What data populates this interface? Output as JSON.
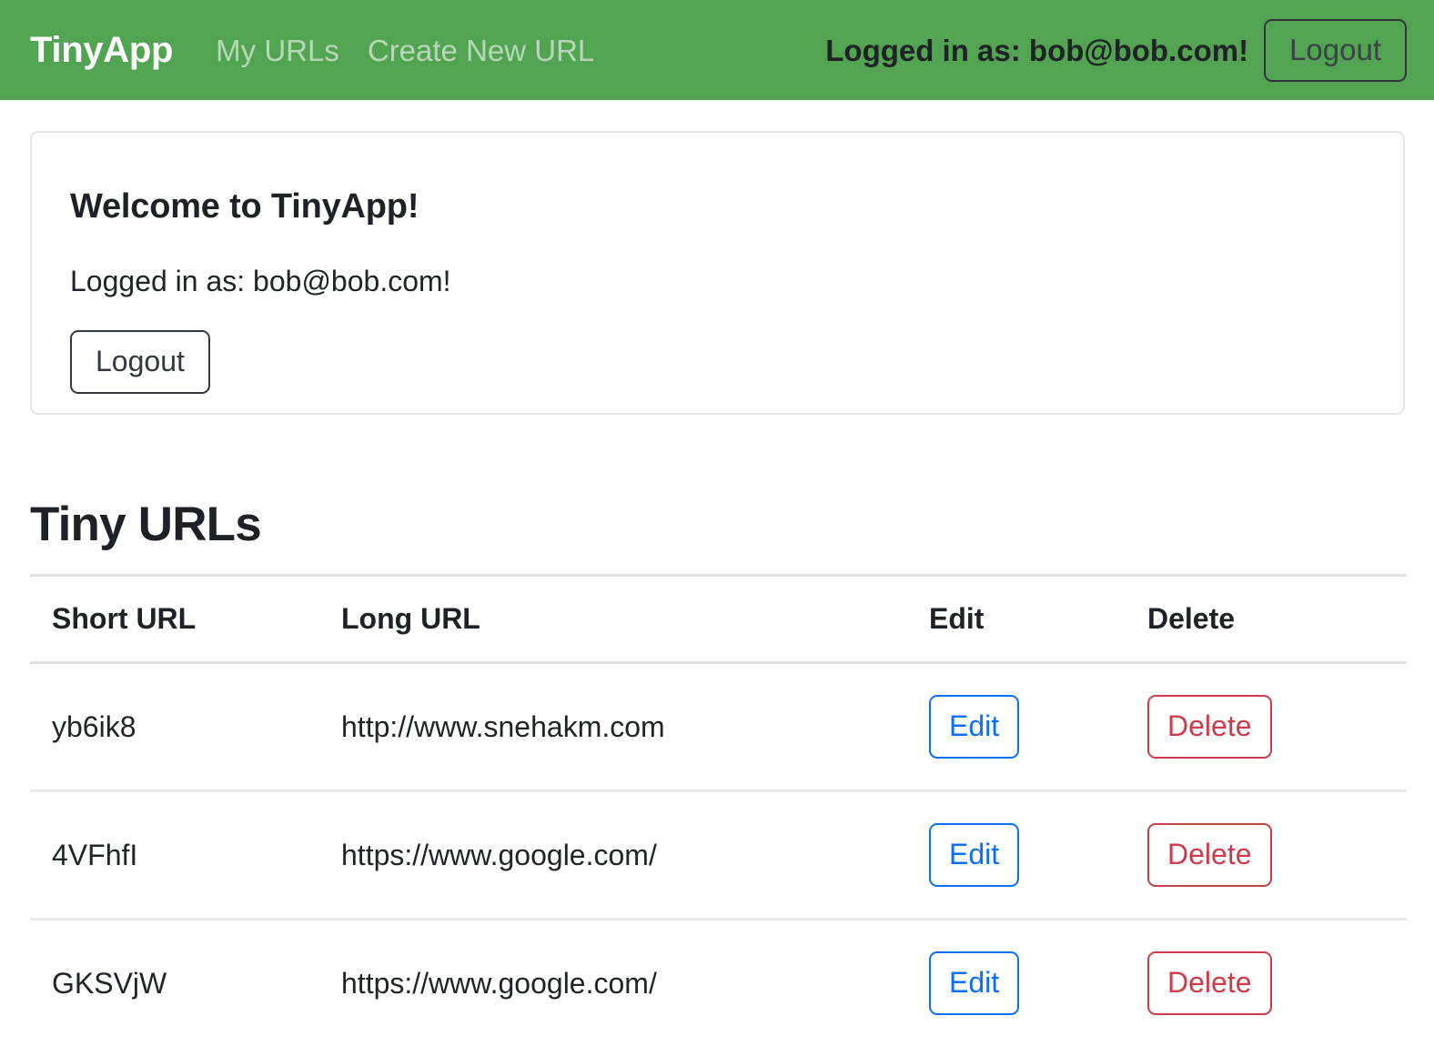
{
  "navbar": {
    "brand": "TinyApp",
    "links": [
      {
        "label": "My URLs"
      },
      {
        "label": "Create New URL"
      }
    ],
    "user_status": "Logged in as: bob@bob.com!",
    "logout_label": "Logout",
    "background_color": "#52a352",
    "brand_color": "#ffffff",
    "link_color": "rgba(255,255,255,0.58)"
  },
  "welcome_card": {
    "title": "Welcome to TinyApp!",
    "status": "Logged in as: bob@bob.com!",
    "logout_label": "Logout",
    "border_color": "#e4e5e7"
  },
  "urls_section": {
    "heading": "Tiny URLs",
    "columns": [
      "Short URL",
      "Long URL",
      "Edit",
      "Delete"
    ],
    "rows": [
      {
        "short_url": "yb6ik8",
        "long_url": "http://www.snehakm.com",
        "edit_label": "Edit",
        "delete_label": "Delete"
      },
      {
        "short_url": "4VFhfI",
        "long_url": "https://www.google.com/",
        "edit_label": "Edit",
        "delete_label": "Delete"
      },
      {
        "short_url": "GKSVjW",
        "long_url": "https://www.google.com/",
        "edit_label": "Edit",
        "delete_label": "Delete"
      }
    ],
    "edit_color": "#0d6efd",
    "delete_color": "#cc3c4a",
    "border_color": "#dfe1e5"
  }
}
